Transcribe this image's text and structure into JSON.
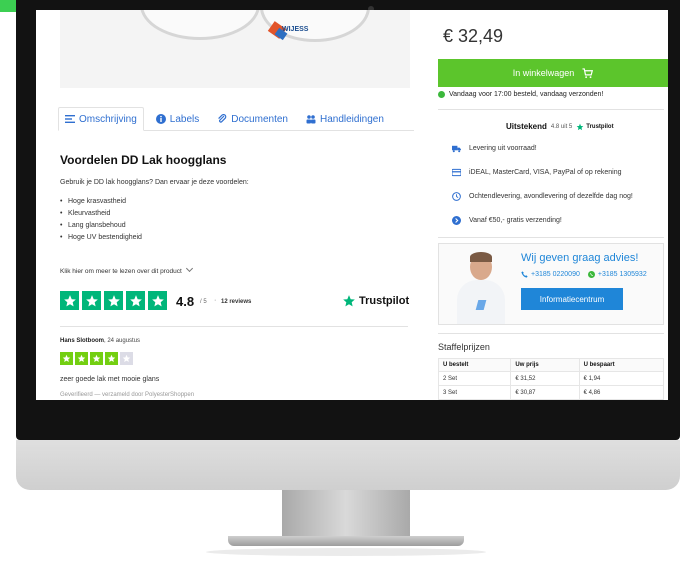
{
  "product": {
    "price": "€ 32,49",
    "add_to_cart_label": "In winkelwagen",
    "shipping_note": "Vandaag voor 17:00 besteld, vandaag verzonden!",
    "image_label": "WIJESS"
  },
  "tabs": [
    {
      "label": "Omschrijving",
      "icon": "list-icon",
      "active": true
    },
    {
      "label": "Labels",
      "icon": "info-icon",
      "active": false
    },
    {
      "label": "Documenten",
      "icon": "paperclip-icon",
      "active": false
    },
    {
      "label": "Handleidingen",
      "icon": "people-icon",
      "active": false
    }
  ],
  "description": {
    "title": "Voordelen DD Lak hoogglans",
    "intro": "Gebruik je DD lak hoogglans? Dan ervaar je deze voordelen:",
    "benefits": [
      "Hoge krasvastheid",
      "Kleurvastheid",
      "Lang glansbehoud",
      "Hoge UV bestendigheid"
    ],
    "read_more": "Klik hier om meer te lezen over dit product"
  },
  "trustpilot": {
    "rating": "4.8",
    "rating_max": "/ 5",
    "separator": "·",
    "reviews": "12 reviews",
    "logo_text": "Trustpilot",
    "summary_label": "Uitstekend",
    "summary_score": "4.8 uit 5",
    "star_count": 5
  },
  "review": {
    "author": "Hans Slotboom",
    "date": ", 24 augustus",
    "stars": 4,
    "text": "zeer goede lak met mooie glans",
    "verified": "Geverifieerd — verzameld door PolyesterShoppen"
  },
  "usps": [
    {
      "icon": "truck-icon",
      "text": "Levering uit voorraad!"
    },
    {
      "icon": "credit-card-icon",
      "text": "iDEAL, MasterCard, VISA, PayPal of op rekening"
    },
    {
      "icon": "clock-icon",
      "text": "Ochtendlevering, avondlevering of dezelfde dag nog!"
    },
    {
      "icon": "arrow-circle-icon",
      "text": "Vanaf €50,- gratis verzending!"
    }
  ],
  "advice": {
    "title": "Wij geven graag advies!",
    "phone": "+3185 0220090",
    "whatsapp": "+3185 1305932",
    "button_label": "Informatiecentrum"
  },
  "staffel": {
    "title": "Staffelprijzen",
    "headers": [
      "U bestelt",
      "Uw prijs",
      "U bespaart"
    ],
    "rows": [
      [
        "2 Set",
        "€ 31,52",
        "€ 1,94"
      ],
      [
        "3 Set",
        "€ 30,87",
        "€ 4,86"
      ]
    ]
  },
  "colors": {
    "accent_green": "#5cc52c",
    "trustpilot_green": "#00b67a",
    "link_blue": "#2f6fd0",
    "advice_blue": "#1f86d8"
  }
}
